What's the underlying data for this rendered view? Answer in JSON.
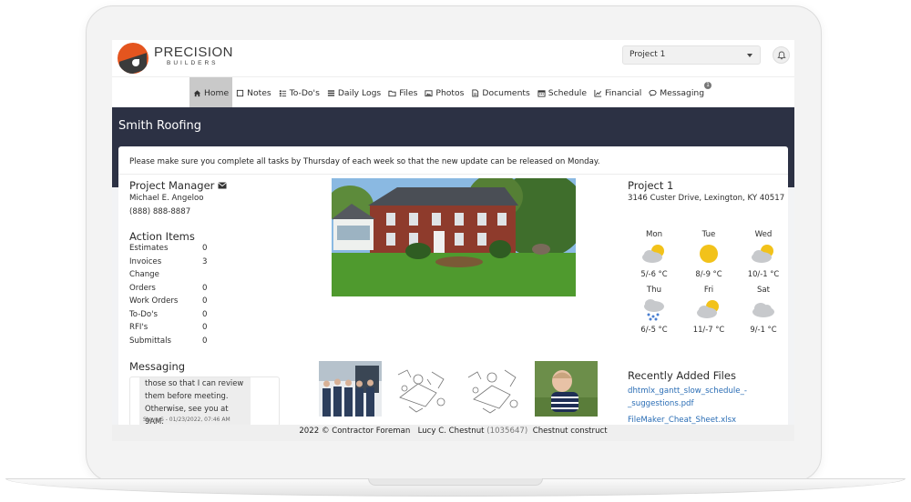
{
  "brand": {
    "name": "PRECISION",
    "sub": "BUILDERS"
  },
  "header": {
    "project_selected": "Project 1"
  },
  "nav": [
    {
      "label": "Home",
      "icon": "home-icon"
    },
    {
      "label": "Notes",
      "icon": "note-icon"
    },
    {
      "label": "To-Do's",
      "icon": "checklist-icon"
    },
    {
      "label": "Daily Logs",
      "icon": "list-icon"
    },
    {
      "label": "Files",
      "icon": "folder-icon"
    },
    {
      "label": "Photos",
      "icon": "image-icon"
    },
    {
      "label": "Documents",
      "icon": "document-icon"
    },
    {
      "label": "Schedule",
      "icon": "calendar-icon"
    },
    {
      "label": "Financial",
      "icon": "chart-icon"
    },
    {
      "label": "Messaging",
      "icon": "chat-icon",
      "badge": "1"
    }
  ],
  "page_title": "Smith Roofing",
  "notice": "Please make sure you complete all tasks by Thursday of each week so that the new update can be released on Monday.",
  "project_manager": {
    "title": "Project Manager",
    "name": "Michael E. Angeloo",
    "phone": "(888) 888-8887"
  },
  "action_items": {
    "title": "Action Items",
    "rows": [
      {
        "label": "Estimates",
        "value": "0"
      },
      {
        "label": "Invoices",
        "value": "3"
      },
      {
        "label": "Change",
        "value": ""
      },
      {
        "label": "Orders",
        "value": "0"
      },
      {
        "label": "Work Orders",
        "value": "0"
      },
      {
        "label": "To-Do's",
        "value": "0"
      },
      {
        "label": "RFI's",
        "value": "0"
      },
      {
        "label": "Submittals",
        "value": "0"
      }
    ]
  },
  "messaging": {
    "title": "Messaging",
    "line1": "those so that I can review",
    "line2": "them before meeting.",
    "line3": "Otherwise, see you at 9AM.",
    "meta": "Steve S - 01/23/2022, 07:46 AM"
  },
  "project": {
    "name": "Project 1",
    "address": "3146 Custer Drive, Lexington, KY 40517"
  },
  "weather": [
    {
      "day": "Mon",
      "icon": "partly-cloudy-icon",
      "temp": "5/-6 °C"
    },
    {
      "day": "Tue",
      "icon": "sun-icon",
      "temp": "8/-9 °C"
    },
    {
      "day": "Wed",
      "icon": "partly-cloudy-icon",
      "temp": "10/-1 °C"
    },
    {
      "day": "Thu",
      "icon": "rain-icon",
      "temp": "6/-5 °C"
    },
    {
      "day": "Fri",
      "icon": "partly-cloudy-icon",
      "temp": "11/-7 °C"
    },
    {
      "day": "Sat",
      "icon": "cloud-icon",
      "temp": "9/-1 °C"
    }
  ],
  "recent_files": {
    "title": "Recently Added Files",
    "files": [
      "dhtmlx_gantt_slow_schedule_-_suggestions.pdf",
      "FileMaker_Cheat_Sheet.xlsx"
    ]
  },
  "footer": {
    "copyright": "2022 © Contractor Foreman",
    "user": "Lucy C. Chestnut",
    "user_id": "(1035647)",
    "company": "Chestnut construct"
  },
  "colors": {
    "band": "#2c3144",
    "link": "#2a6db5",
    "brand_orange": "#e4551f"
  }
}
